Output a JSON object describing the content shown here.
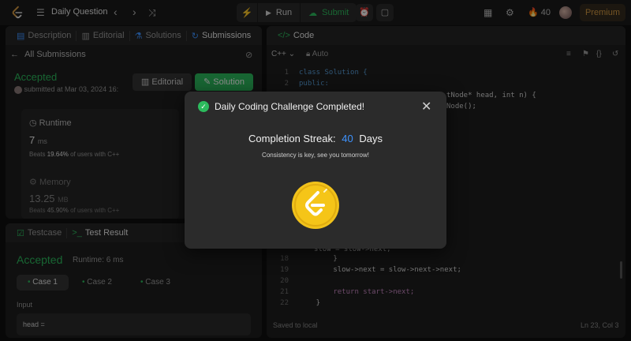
{
  "topbar": {
    "title": "Daily Question",
    "run_label": "Run",
    "submit_label": "Submit",
    "streak_count": "40",
    "premium_label": "Premium"
  },
  "left_panel": {
    "tabs": [
      {
        "label": "Description",
        "icon": "document-icon"
      },
      {
        "label": "Editorial",
        "icon": "book-icon"
      },
      {
        "label": "Solutions",
        "icon": "flask-icon"
      },
      {
        "label": "Submissions",
        "icon": "history-icon"
      }
    ],
    "back_label": "All Submissions",
    "status": "Accepted",
    "submitted": "submitted at Mar 03, 2024 16:",
    "editorial_button": "Editorial",
    "solution_button": "Solution",
    "runtime_label": "Runtime",
    "runtime_value": "7",
    "runtime_unit": "ms",
    "runtime_beats_pre": "Beats",
    "runtime_beats_pct": "19.64%",
    "runtime_beats_post": "of users with C++",
    "memory_label": "Memory",
    "memory_value": "13.25",
    "memory_unit": "MB",
    "memory_beats_pre": "Beats",
    "memory_beats_pct": "45.90%",
    "memory_beats_post": "of users with C++"
  },
  "bottom_panel": {
    "testcase_tab": "Testcase",
    "result_tab": "Test Result",
    "status": "Accepted",
    "runtime": "Runtime: 6 ms",
    "cases": [
      "Case 1",
      "Case 2",
      "Case 3"
    ],
    "input_label": "Input",
    "input_value": "head ="
  },
  "code_panel": {
    "title": "Code",
    "language": "C++",
    "auto_label": "Auto",
    "saved": "Saved to local",
    "position": "Ln 23, Col 3",
    "lines_top": [
      {
        "n": "1",
        "code": "class Solution {"
      },
      {
        "n": "2",
        "code": "public:"
      }
    ],
    "line3_tail": "tNode* head, int n) {",
    "line4_tail": "Node();",
    "partial_line": "slow = slow->next;",
    "lines_bottom": [
      {
        "n": "18",
        "code": "        }"
      },
      {
        "n": "19",
        "code": "        slow->next = slow->next->next;"
      },
      {
        "n": "20",
        "code": ""
      },
      {
        "n": "21",
        "code": "        return start->next;"
      },
      {
        "n": "22",
        "code": "    }"
      }
    ]
  },
  "modal": {
    "title": "Daily Coding Challenge Completed!",
    "streak_label": "Completion Streak:",
    "streak_value": "40",
    "streak_unit": "Days",
    "subtitle": "Consistency is key, see you tomorrow!"
  },
  "colors": {
    "accent_green": "#2cbb5d",
    "accent_blue": "#3e93ff",
    "premium": "#d59a43",
    "coin": "#f5c518"
  }
}
